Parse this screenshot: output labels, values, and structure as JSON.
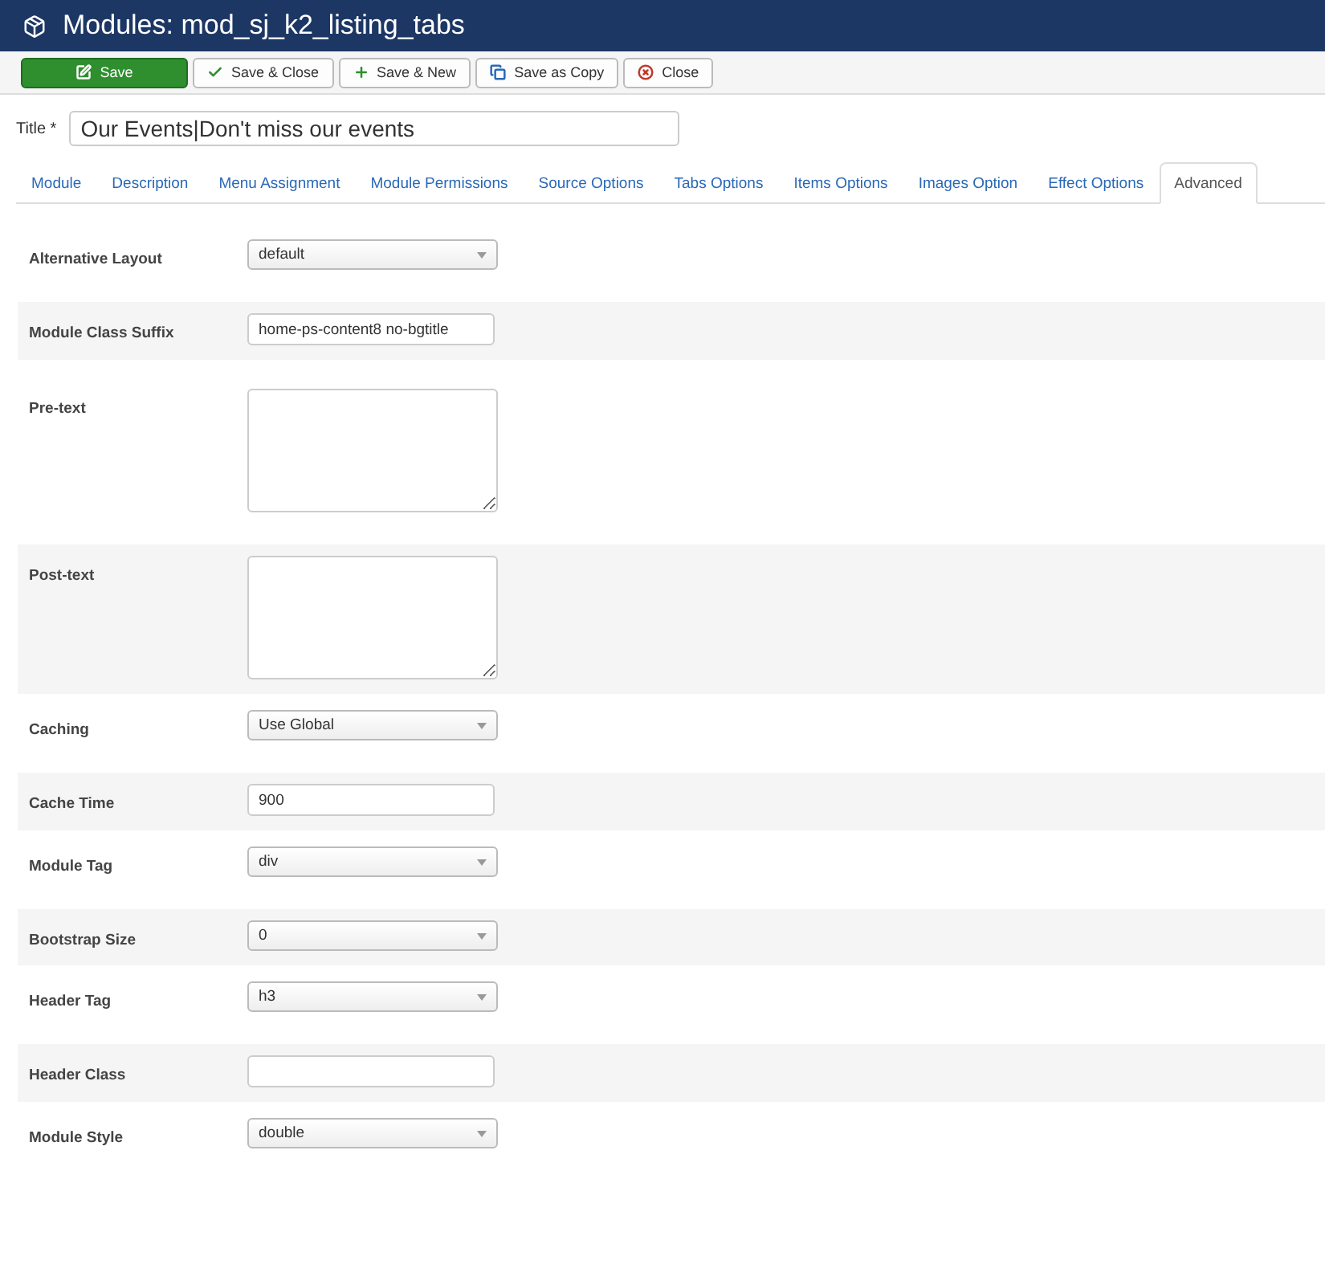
{
  "header": {
    "title": "Modules: mod_sj_k2_listing_tabs"
  },
  "toolbar": [
    {
      "label": "Save",
      "kind": "save"
    },
    {
      "label": "Save & Close",
      "kind": "check"
    },
    {
      "label": "Save & New",
      "kind": "plus"
    },
    {
      "label": "Save as Copy",
      "kind": "copy"
    },
    {
      "label": "Close",
      "kind": "close"
    }
  ],
  "title_field": {
    "label": "Title *",
    "value": "Our Events|Don't miss our events"
  },
  "tabs": [
    {
      "label": "Module",
      "selected": false
    },
    {
      "label": "Description",
      "selected": false
    },
    {
      "label": "Menu Assignment",
      "selected": false
    },
    {
      "label": "Module Permissions",
      "selected": false
    },
    {
      "label": "Source Options",
      "selected": false
    },
    {
      "label": "Tabs Options",
      "selected": false
    },
    {
      "label": "Items Options",
      "selected": false
    },
    {
      "label": "Images Option",
      "selected": false
    },
    {
      "label": "Effect Options",
      "selected": false
    },
    {
      "label": "Advanced",
      "selected": true
    }
  ],
  "fields": [
    {
      "label": "Alternative Layout",
      "kind": "select",
      "value": "default"
    },
    {
      "label": "Module Class Suffix",
      "kind": "text",
      "value": "home-ps-content8 no-bgtitle"
    },
    {
      "label": "Pre-text",
      "kind": "textarea"
    },
    {
      "label": "Post-text",
      "kind": "textarea"
    },
    {
      "label": "Caching",
      "kind": "select",
      "value": "Use Global"
    },
    {
      "label": "Cache Time",
      "kind": "text",
      "value": "900"
    },
    {
      "label": "Module Tag",
      "kind": "select",
      "value": "div"
    },
    {
      "label": "Bootstrap Size",
      "kind": "select",
      "value": "0"
    },
    {
      "label": "Header Tag",
      "kind": "select",
      "value": "h3"
    },
    {
      "label": "Header Class",
      "kind": "text"
    },
    {
      "label": "Module Style",
      "kind": "select",
      "value": "double"
    }
  ]
}
